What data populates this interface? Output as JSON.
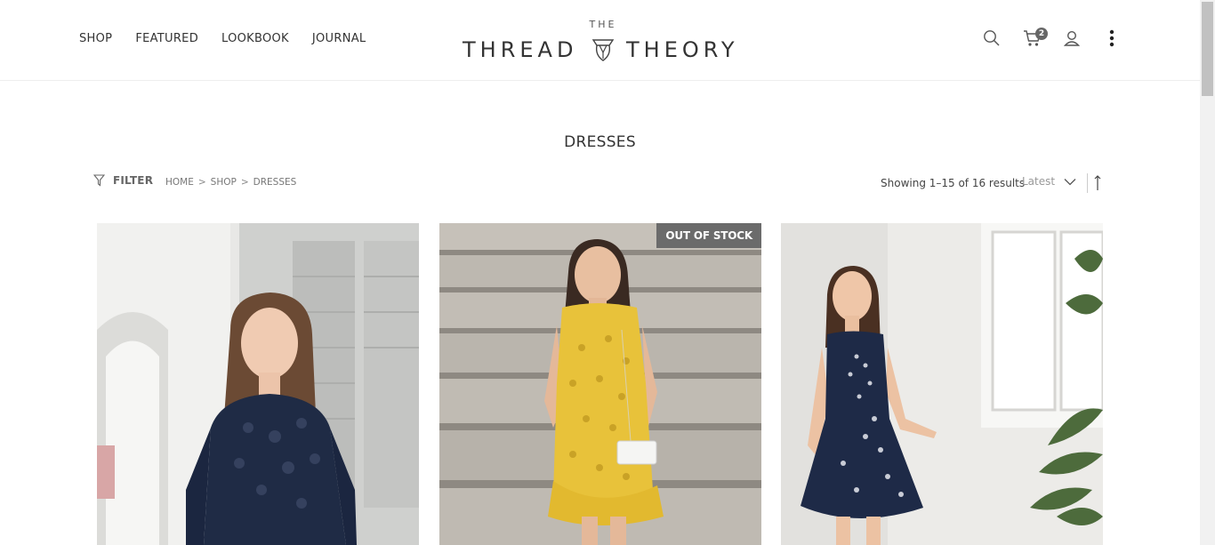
{
  "nav": {
    "items": [
      "SHOP",
      "FEATURED",
      "LOOKBOOK",
      "JOURNAL"
    ]
  },
  "logo": {
    "top": "THE",
    "left": "THREAD",
    "right": "THEORY"
  },
  "header_icons": {
    "search": "search-icon",
    "cart": "cart-icon",
    "cart_count": "2",
    "account": "user-icon",
    "more": "more-vertical-icon"
  },
  "page": {
    "title": "DRESSES"
  },
  "toolbar": {
    "filter_label": "FILTER",
    "breadcrumb": [
      "HOME",
      "SHOP",
      "DRESSES"
    ],
    "breadcrumb_sep": ">",
    "results_text": "Showing 1–15 of 16 results",
    "sort_value": "Latest"
  },
  "products": [
    {
      "image": "woman in navy lace three-quarter sleeve dress",
      "badge": ""
    },
    {
      "image": "woman in yellow eyelet sleeveless dress on stone steps",
      "badge": "OUT OF STOCK"
    },
    {
      "image": "woman in navy floral-embroidered skater dress by window",
      "badge": ""
    }
  ],
  "colors": {
    "text": "#333333",
    "muted": "#777777",
    "badge_bg": "#6b6b6b",
    "cart_badge": "#666666"
  }
}
